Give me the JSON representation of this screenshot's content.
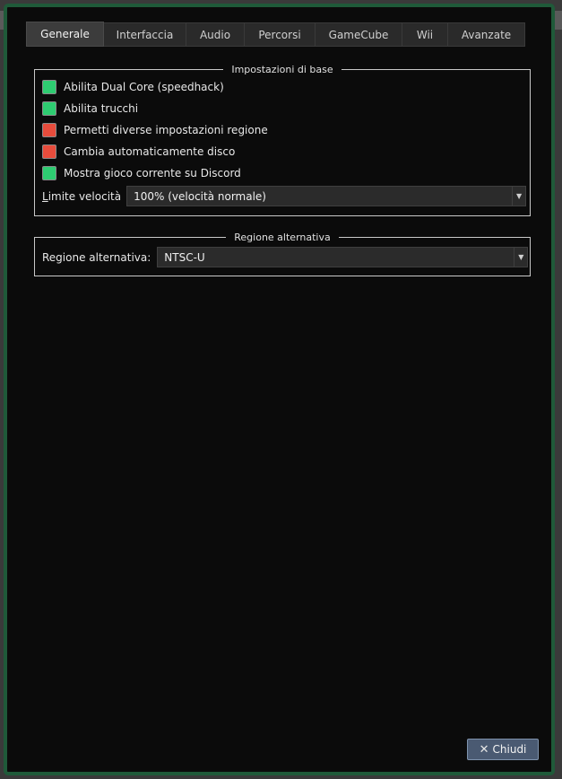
{
  "tabs": [
    {
      "label": "Generale"
    },
    {
      "label": "Interfaccia"
    },
    {
      "label": "Audio"
    },
    {
      "label": "Percorsi"
    },
    {
      "label": "GameCube"
    },
    {
      "label": "Wii"
    },
    {
      "label": "Avanzate"
    }
  ],
  "basic": {
    "title": "Impostazioni di base",
    "checkboxes": [
      {
        "label": "Abilita Dual Core (speedhack)",
        "checked": true
      },
      {
        "label": "Abilita trucchi",
        "checked": true
      },
      {
        "label": "Permetti diverse impostazioni regione",
        "checked": false
      },
      {
        "label": "Cambia automaticamente disco",
        "checked": false
      },
      {
        "label": "Mostra gioco corrente su Discord",
        "checked": true
      }
    ],
    "speed_label_accel": "L",
    "speed_label_rest": "imite velocità",
    "speed_value": "100% (velocità normale)"
  },
  "region": {
    "title": "Regione alternativa",
    "label": "Regione alternativa:",
    "value": "NTSC-U"
  },
  "close_label": "Chiudi",
  "colors": {
    "checked": "#2ecc71",
    "unchecked": "#e74c3c",
    "frame": "#1f5a39"
  }
}
